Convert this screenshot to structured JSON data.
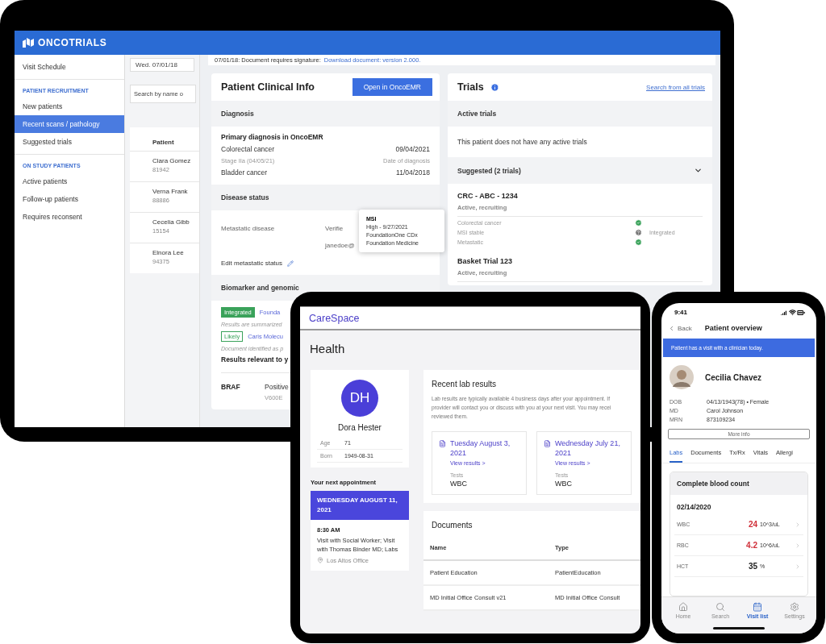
{
  "laptop": {
    "logo": "ONCOTRIALS",
    "sidebar": [
      {
        "kind": "item",
        "label": "Visit Schedule",
        "selected": false
      },
      {
        "kind": "heading",
        "label": "PATIENT RECRUITMENT"
      },
      {
        "kind": "item",
        "label": "New patients",
        "selected": false
      },
      {
        "kind": "item",
        "label": "Recent scans / pathology",
        "selected": true
      },
      {
        "kind": "item",
        "label": "Suggested trials",
        "selected": false
      },
      {
        "kind": "heading",
        "label": "ON STUDY PATIENTS"
      },
      {
        "kind": "item",
        "label": "Active patients",
        "selected": false
      },
      {
        "kind": "item",
        "label": "Follow-up patients",
        "selected": false
      },
      {
        "kind": "item",
        "label": "Requires reconsent",
        "selected": false
      }
    ],
    "list_panel": {
      "date": "Wed. 07/01/18",
      "search": {
        "placeholder": "Search by name o"
      },
      "column": "Patient",
      "patients": [
        {
          "name": "Clara Gomez",
          "id": "81942"
        },
        {
          "name": "Verna Frank",
          "id": "88886"
        },
        {
          "name": "Cecelia Gibb",
          "id": "15154"
        },
        {
          "name": "Elnora Lee",
          "id": "94375"
        }
      ]
    },
    "notice": {
      "text": "07/01/18: Document requires signature:",
      "link": "Download document: version 2.000."
    },
    "clinical": {
      "title": "Patient Clinical Info",
      "button": "Open in OncoEMR",
      "diagnosis": {
        "heading": "Diagnosis",
        "subtitle": "Primary diagnosis in OncoEMR",
        "rows": [
          {
            "kind": "main",
            "left": "Colorectal cancer",
            "right": "09/04/2021"
          },
          {
            "kind": "sub",
            "left": "Stage IIa (04/05/21)",
            "right": "Date of diagnosis"
          },
          {
            "kind": "main",
            "left": "Bladder cancer",
            "right": "11/04/2018"
          }
        ]
      },
      "disease": {
        "heading": "Disease status",
        "label": "Metastatic disease",
        "status": "Verifie",
        "user": "janedoe@",
        "edit": "Edit metastatic status"
      },
      "biomarker": {
        "heading": "Biomarker and genomic",
        "items": [
          {
            "badge": "Integrated",
            "kind": "filled",
            "link": "Founda",
            "note": "Results are summarized"
          },
          {
            "badge": "Likely",
            "kind": "outline",
            "link": "Caris Molecu",
            "note": "Document identified as p"
          }
        ],
        "relevant": "Results relevant to y",
        "gene": {
          "name": "BRAF",
          "result": "Positive",
          "variant": "V600E"
        }
      }
    },
    "tooltip": {
      "title": "MSI",
      "lines": [
        "High - 9/27/2021",
        "FoundationOne CDx",
        "Foundation Medicine"
      ]
    },
    "trials": {
      "title": "Trials",
      "link": "Search from all trials",
      "active": {
        "heading": "Active trials",
        "text": "This patient does not have any active trials"
      },
      "suggested": {
        "heading": "Suggested (2 trials)",
        "items": [
          {
            "name": "CRC - ABC - 1234",
            "status": "Active, recruiting",
            "criteria": [
              {
                "label": "Colorectal cancer",
                "kind": "met"
              },
              {
                "label": "MSI stable",
                "kind": "unknown",
                "note": "Integrated"
              },
              {
                "label": "Metastatic",
                "kind": "met"
              }
            ]
          },
          {
            "name": "Basket Trial 123",
            "status": "Active, recruiting"
          }
        ]
      }
    }
  },
  "tablet": {
    "brand": "CareSpace",
    "title": "Health",
    "profile": {
      "initials": "DH",
      "name": "Dora Hester",
      "details": [
        {
          "label": "Age",
          "value": "71"
        },
        {
          "label": "Born",
          "value": "1949-08-31"
        }
      ]
    },
    "appointment": {
      "heading": "Your next appointment",
      "date": "WEDNESDAY AUGUST 11, 2021",
      "time": "8:30 AM",
      "description": "Visit with Social Worker; Visit with Thomas Binder MD; Labs",
      "location": "Los Altos Office"
    },
    "labs": {
      "title": "Recent lab results",
      "lines": [
        "Lab results are typically available 4 business days after your appointment. If",
        "provider will contact you or discuss with you at your next visit. You may recei",
        "reviewed them."
      ],
      "results": [
        {
          "date": "Tuesday August 3, 2021",
          "link": "View results >",
          "tests_label": "Tests",
          "tests": "WBC"
        },
        {
          "date": "Wednesday July 21, 2021",
          "link": "View results >",
          "tests_label": "Tests",
          "tests": "WBC"
        }
      ]
    },
    "documents": {
      "title": "Documents",
      "columns": [
        "Name",
        "Type"
      ],
      "rows": [
        [
          "Patient Education",
          "PatientEducation"
        ],
        [
          "MD Initial Office Consult v21",
          "MD Initial Office Consult"
        ]
      ]
    }
  },
  "phone": {
    "time": "9:41",
    "back": "Back",
    "title": "Patient overview",
    "banner": "Patient has a visit with a clinician today.",
    "name": "Cecilia Chavez",
    "details": [
      {
        "label": "DOB",
        "value": "04/13/1943(78) • Female"
      },
      {
        "label": "MD",
        "value": "Carol Johnson"
      },
      {
        "label": "MRN",
        "value": "873109234"
      }
    ],
    "more": "More info",
    "tabs": [
      {
        "label": "Labs",
        "selected": true
      },
      {
        "label": "Documents",
        "selected": false
      },
      {
        "label": "Tx/Rx",
        "selected": false
      },
      {
        "label": "Vitals",
        "selected": false
      },
      {
        "label": "Allergi",
        "selected": false
      }
    ],
    "card": {
      "title": "Complete blood count",
      "date": "02/14/2020",
      "rows": [
        {
          "label": "WBC",
          "value": "24",
          "unit": "10^3/uL",
          "abnormal": true
        },
        {
          "label": "RBC",
          "value": "4.2",
          "unit": "10^6/uL",
          "abnormal": true
        },
        {
          "label": "HCT",
          "value": "35",
          "unit": "%",
          "abnormal": false
        }
      ]
    },
    "nav": [
      {
        "kind": "home",
        "label": "Home",
        "selected": false
      },
      {
        "kind": "search",
        "label": "Search",
        "selected": false
      },
      {
        "kind": "calendar",
        "label": "Visit list",
        "selected": true
      },
      {
        "kind": "settings",
        "label": "Settings",
        "selected": false
      }
    ]
  }
}
